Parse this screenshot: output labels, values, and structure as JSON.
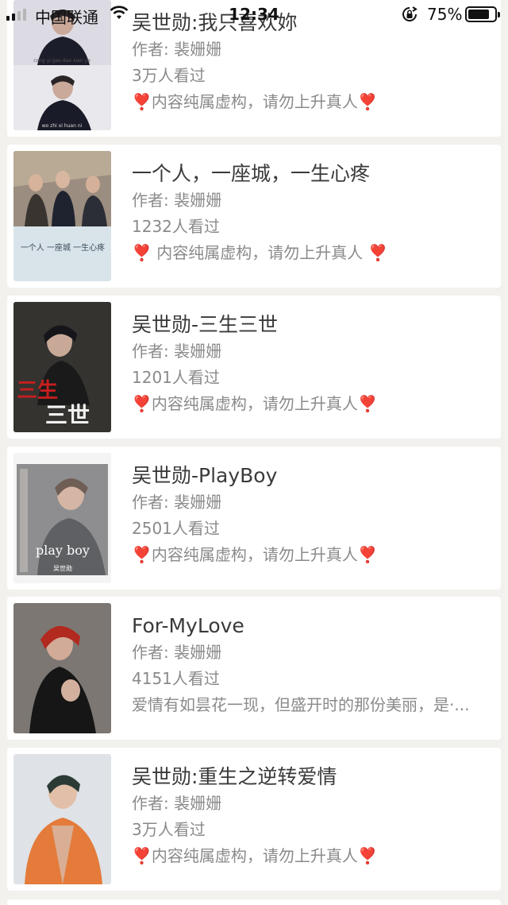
{
  "status_bar": {
    "carrier": "中国联通",
    "time": "12:34",
    "battery_percent": "75%",
    "battery_level": 0.75,
    "signal_bars": 2
  },
  "cards": [
    {
      "title": "吴世勋:我只喜欢妳",
      "author": "作者: 裴姗姗",
      "views": "3万人看过",
      "desc": "❣️内容纯属虚构，请勿上升真人❣️",
      "cover_caption_1": "cong yi gao dao xian ye",
      "cover_caption_2": "wo zhi xi huan ni"
    },
    {
      "title": "一个人，一座城，一生心疼",
      "author": "作者: 裴姗姗",
      "views": "1232人看过",
      "desc": "❣️ 内容纯属虚构，请勿上升真人 ❣️",
      "cover_text": "一个人 一座城 一生心疼"
    },
    {
      "title": "吴世勋-三生三世",
      "author": "作者: 裴姗姗",
      "views": "1201人看过",
      "desc": "❣️内容纯属虚构，请勿上升真人❣️",
      "cover_text_red": "三生",
      "cover_text_white": "三世"
    },
    {
      "title": "吴世勋-PlayBoy",
      "author": "作者: 裴姗姗",
      "views": "2501人看过",
      "desc": "❣️内容纯属虚构，请勿上升真人❣️",
      "cover_text": "play boy",
      "cover_sub": "吴世勋"
    },
    {
      "title": "For-MyLove",
      "author": "作者: 裴姗姗",
      "views": "4151人看过",
      "desc": "爱情有如昙花一现，但盛开时的那份美丽，是·..."
    },
    {
      "title": "吴世勋:重生之逆转爱情",
      "author": "作者: 裴姗姗",
      "views": "3万人看过",
      "desc": "❣️内容纯属虚构，请勿上升真人❣️"
    }
  ]
}
